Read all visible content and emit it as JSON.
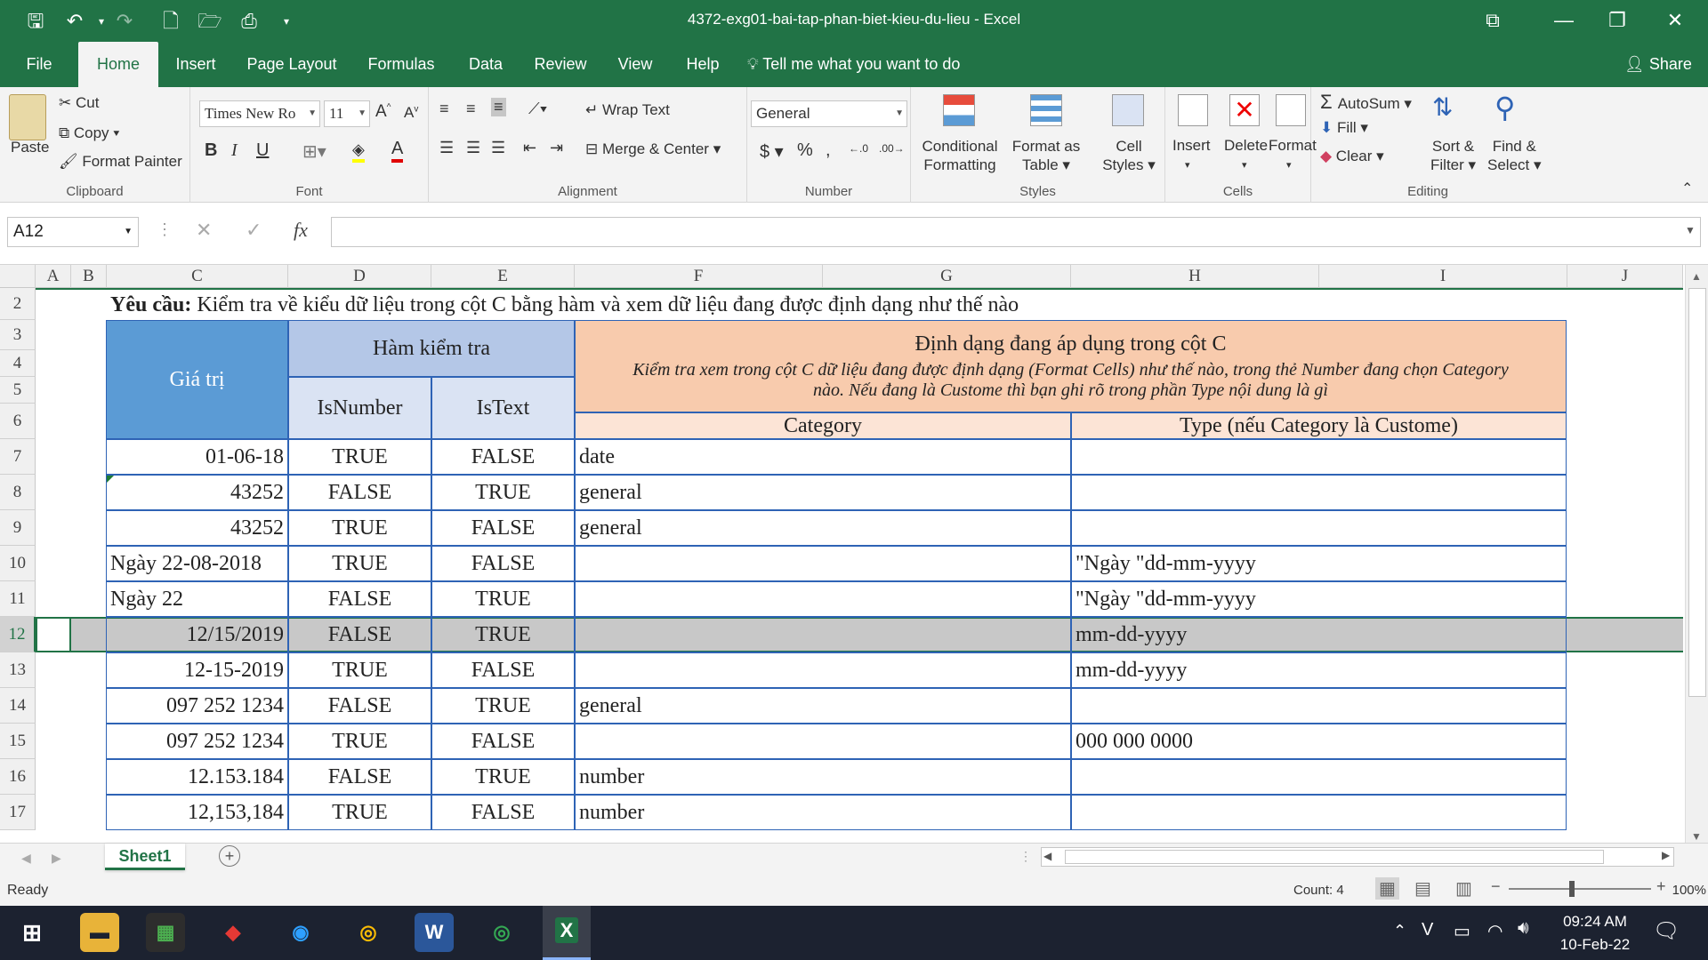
{
  "window": {
    "title": "4372-exg01-bai-tap-phan-biet-kieu-du-lieu  -  Excel"
  },
  "tabs": [
    "File",
    "Home",
    "Insert",
    "Page Layout",
    "Formulas",
    "Data",
    "Review",
    "View",
    "Help"
  ],
  "tell_me": "Tell me what you want to do",
  "share": "Share",
  "ribbon": {
    "clipboard": {
      "paste": "Paste",
      "cut": "Cut",
      "copy": "Copy",
      "format_painter": "Format Painter",
      "label": "Clipboard"
    },
    "font": {
      "name": "Times New Ro",
      "size": "11",
      "bold": "B",
      "italic": "I",
      "underline": "U",
      "label": "Font"
    },
    "alignment": {
      "wrap": "Wrap Text",
      "merge": "Merge & Center",
      "label": "Alignment"
    },
    "number": {
      "format": "General",
      "label": "Number"
    },
    "styles": {
      "conditional": "Conditional",
      "conditional2": "Formatting",
      "format_as": "Format as",
      "table": "Table",
      "cell": "Cell",
      "styles": "Styles",
      "label": "Styles"
    },
    "cells": {
      "insert": "Insert",
      "delete": "Delete",
      "format": "Format",
      "label": "Cells"
    },
    "editing": {
      "autosum": "AutoSum",
      "fill": "Fill",
      "clear": "Clear",
      "sort": "Sort &",
      "filter": "Filter",
      "find": "Find &",
      "select": "Select",
      "label": "Editing"
    }
  },
  "name_box": "A12",
  "fx": "fx",
  "columns": [
    "A",
    "B",
    "C",
    "D",
    "E",
    "F",
    "G",
    "H",
    "I",
    "J"
  ],
  "rows": [
    "2",
    "3",
    "4",
    "5",
    "6",
    "7",
    "8",
    "9",
    "10",
    "11",
    "12",
    "13",
    "14",
    "15",
    "16",
    "17"
  ],
  "sheet": {
    "title_bold": "Yêu cầu:",
    "title_rest": " Kiểm tra về kiểu dữ liệu trong cột C bằng hàm và xem dữ liệu đang được định dạng như thế nào",
    "hdr_value": "Giá trị",
    "hdr_func": "Hàm kiểm tra",
    "hdr_isnumber": "IsNumber",
    "hdr_istext": "IsText",
    "hdr_format": "Định dạng đang áp dụng trong cột C",
    "hdr_format_note1": "Kiểm tra xem trong cột C dữ liệu đang được định dạng (Format Cells) như thế nào, trong thẻ Number đang chọn Category",
    "hdr_format_note2": "nào. Nếu đang là Custome thì bạn ghi rõ trong phần Type nội dung là gì",
    "hdr_category": "Category",
    "hdr_type": "Type (nếu Category là Custome)",
    "data": [
      {
        "value": "01-06-18",
        "align": "right",
        "isnumber": "TRUE",
        "istext": "FALSE",
        "category": "date",
        "type": ""
      },
      {
        "value": "43252",
        "align": "right",
        "isnumber": "FALSE",
        "istext": "TRUE",
        "category": "general",
        "type": ""
      },
      {
        "value": "43252",
        "align": "right",
        "isnumber": "TRUE",
        "istext": "FALSE",
        "category": "general",
        "type": ""
      },
      {
        "value": "Ngày 22-08-2018",
        "align": "left",
        "isnumber": "TRUE",
        "istext": "FALSE",
        "category": "",
        "type": "\"Ngày \"dd-mm-yyyy"
      },
      {
        "value": "Ngày 22",
        "align": "left",
        "isnumber": "FALSE",
        "istext": "TRUE",
        "category": "",
        "type": "\"Ngày \"dd-mm-yyyy"
      },
      {
        "value": "12/15/2019",
        "align": "right",
        "isnumber": "FALSE",
        "istext": "TRUE",
        "category": "",
        "type": "mm-dd-yyyy"
      },
      {
        "value": "12-15-2019",
        "align": "right",
        "isnumber": "TRUE",
        "istext": "FALSE",
        "category": "",
        "type": "mm-dd-yyyy"
      },
      {
        "value": "097 252 1234",
        "align": "right",
        "isnumber": "FALSE",
        "istext": "TRUE",
        "category": "general",
        "type": ""
      },
      {
        "value": "097 252 1234",
        "align": "right",
        "isnumber": "TRUE",
        "istext": "FALSE",
        "category": "",
        "type": "000 000 0000"
      },
      {
        "value": "12.153.184",
        "align": "right",
        "isnumber": "FALSE",
        "istext": "TRUE",
        "category": "number",
        "type": ""
      },
      {
        "value": "12,153,184",
        "align": "right",
        "isnumber": "TRUE",
        "istext": "FALSE",
        "category": "number",
        "type": ""
      }
    ]
  },
  "sheet_tab": "Sheet1",
  "status": {
    "ready": "Ready",
    "count": "Count: 4",
    "zoom": "100%"
  },
  "clock": {
    "time": "09:24 AM",
    "date": "10-Feb-22"
  },
  "colors": {
    "excel_green": "#217346",
    "header_blue": "#5b9bd5",
    "header_lightblue": "#b4c7e7",
    "header_isbg": "#dae3f3",
    "header_orange": "#f8cbad",
    "header_lightorange": "#fce4d6",
    "selected_row": "#c8c8c8"
  }
}
